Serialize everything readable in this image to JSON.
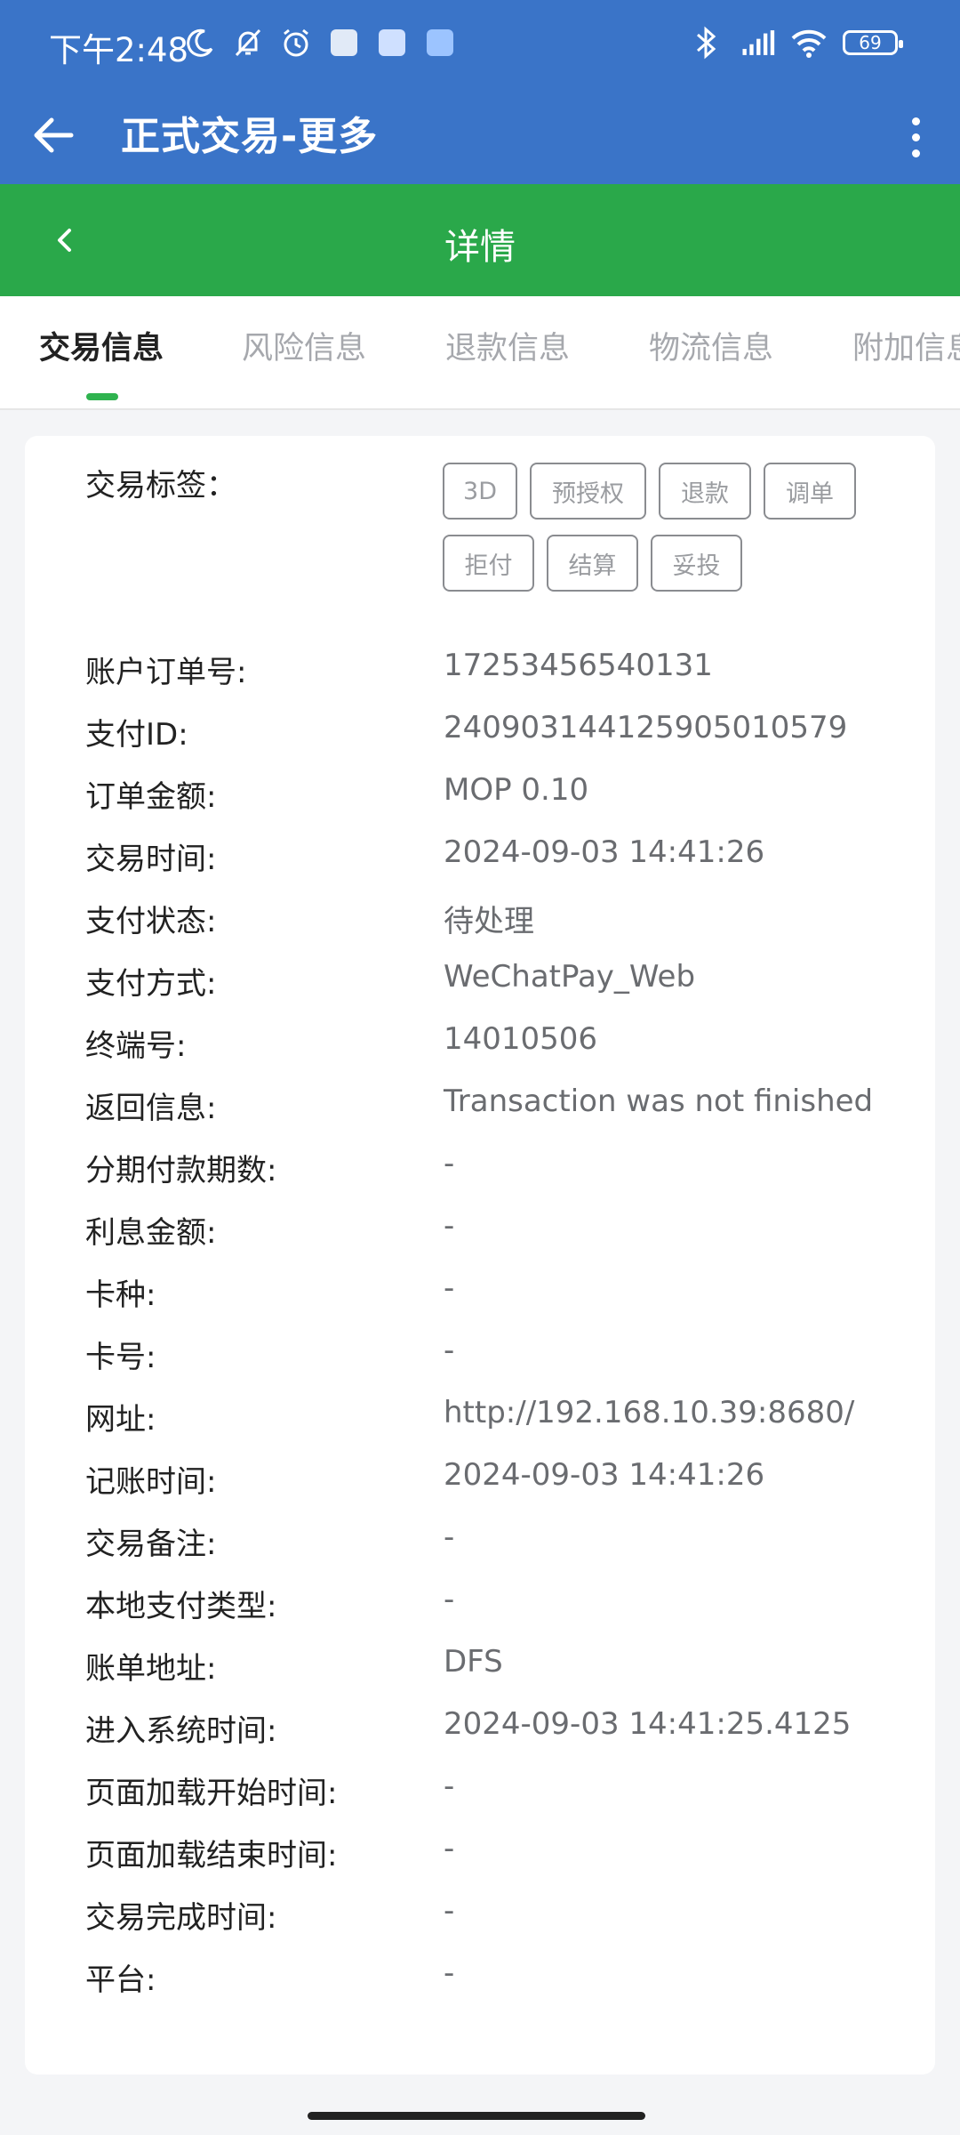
{
  "status": {
    "time": "下午2:48",
    "battery": "69",
    "left_icons": [
      "moon-icon",
      "bell-off-icon",
      "alarm-icon",
      "app-icon",
      "browser-icon",
      "translate-icon"
    ],
    "right_icons": [
      "bluetooth-icon",
      "hd-signal-icon",
      "wifi-icon",
      "battery-icon"
    ]
  },
  "appbar": {
    "title": "正式交易-更多"
  },
  "detail": {
    "title": "详情"
  },
  "tabs": [
    "交易信息",
    "风险信息",
    "退款信息",
    "物流信息",
    "附加信息"
  ],
  "active_tab": 0,
  "tags": {
    "label": "交易标签：",
    "items": [
      "3D",
      "预授权",
      "退款",
      "调单",
      "拒付",
      "结算",
      "妥投"
    ]
  },
  "fields": [
    {
      "label": "账户订单号:",
      "value": "17253456540131"
    },
    {
      "label": "支付ID:",
      "value": "2409031441259050105​79"
    },
    {
      "label": "订单金额:",
      "value": "MOP 0.10"
    },
    {
      "label": "交易时间:",
      "value": "2024-09-03 14:41:26"
    },
    {
      "label": "支付状态:",
      "value": "待处理"
    },
    {
      "label": "支付方式:",
      "value": "WeChatPay_Web"
    },
    {
      "label": "终端号:",
      "value": "14010506"
    },
    {
      "label": "返回信息:",
      "value": "Transaction was not finished"
    },
    {
      "label": "分期付款期数:",
      "value": "-"
    },
    {
      "label": "利息金额:",
      "value": "-"
    },
    {
      "label": "卡种:",
      "value": "-"
    },
    {
      "label": "卡号:",
      "value": "-"
    },
    {
      "label": "网址:",
      "value": "http://192.168.10.39:8680/"
    },
    {
      "label": "记账时间:",
      "value": "2024-09-03 14:41:26"
    },
    {
      "label": "交易备注:",
      "value": "-"
    },
    {
      "label": "本地支付类型:",
      "value": "-"
    },
    {
      "label": "账单地址:",
      "value": "DFS"
    },
    {
      "label": "进入系统时间:",
      "value": "2024-09-03 14:41:25.4125"
    },
    {
      "label": "页面加载开始时间:",
      "value": "-"
    },
    {
      "label": "页面加载结束时间:",
      "value": "-"
    },
    {
      "label": "交易完成时间:",
      "value": "-"
    },
    {
      "label": "平台:",
      "value": "-"
    }
  ],
  "colors": {
    "primary": "#3a74c8",
    "accent": "#2aa84a",
    "indicator": "#2fb34f"
  }
}
